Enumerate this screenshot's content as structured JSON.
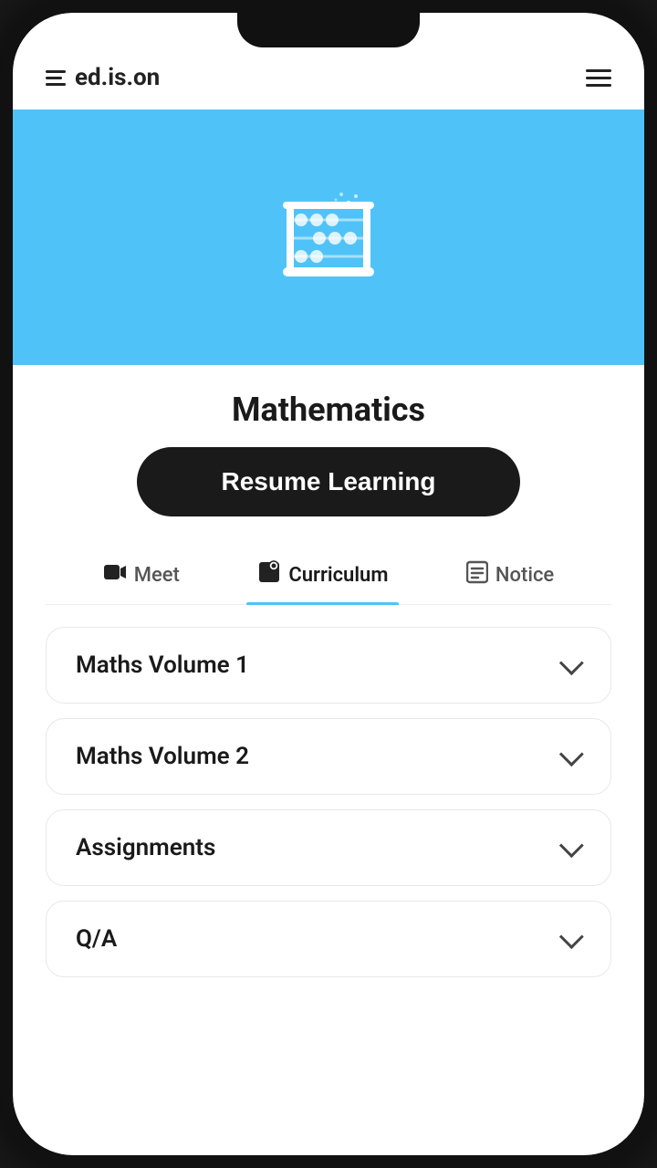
{
  "app": {
    "logo_text": "ed.is.on"
  },
  "hero": {
    "subject_icon_alt": "abacus"
  },
  "course": {
    "title": "Mathematics",
    "resume_button_label": "Resume Learning"
  },
  "tabs": [
    {
      "id": "meet",
      "label": "Meet",
      "icon": "📹",
      "active": false
    },
    {
      "id": "curriculum",
      "label": "Curriculum",
      "icon": "💾",
      "active": true
    },
    {
      "id": "notice",
      "label": "Notice",
      "icon": "📋",
      "active": false
    }
  ],
  "accordion_items": [
    {
      "id": "maths-vol-1",
      "label": "Maths Volume 1"
    },
    {
      "id": "maths-vol-2",
      "label": "Maths Volume 2"
    },
    {
      "id": "assignments",
      "label": "Assignments"
    },
    {
      "id": "qa",
      "label": "Q/A"
    }
  ]
}
